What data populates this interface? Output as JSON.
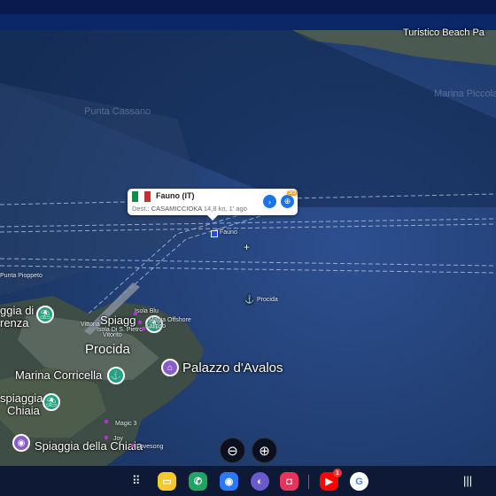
{
  "map": {
    "labels_top": {
      "beach": "Turistico Beach Pa",
      "ghost1": "Punta Cassano",
      "ghost2": "Marina Piccola"
    },
    "vessel": {
      "name_marker": "Fauno",
      "popup_title": "Fauno (IT)",
      "dest_label": "Dest.:",
      "dest_value": "CASAMICCIOKA",
      "speed": "14,8 kn",
      "age": "1' ago",
      "badge": "3/3"
    },
    "places": {
      "punta_pioppeto": "Punta Pioppeto",
      "procida_anchor": "Procida",
      "spiagg_di_lines": [
        "ggia di",
        "renza"
      ],
      "spiagg": "Spiagg",
      "isola_blu": "Isola Blu",
      "magia": "Magia Offshore",
      "kalipso": "Kalipso",
      "vittoria": "Vittoria",
      "isola_di_s_pietro": "Isola Di S. Pietro",
      "vito": "Vitorito",
      "procida_town": "Procida",
      "palazzo": "Palazzo d'Avalos",
      "marina_corricella": "Marina Corricella",
      "spiaggia_chiaia_lines": [
        "spiaggia",
        "Chiaia"
      ],
      "spiaggia_della_chiaia": "Spiaggia della Chiaia",
      "magic3": "Magic 3",
      "joy": "Joy",
      "lovesong": "Lovesong"
    },
    "zoom_out_icon": "zoom-out-icon",
    "zoom_in_icon": "zoom-in-icon"
  },
  "taskbar": {
    "apps": [
      {
        "name": "apps-grid-icon"
      },
      {
        "name": "notes-app-icon",
        "color": "#f7c82c"
      },
      {
        "name": "phone-app-icon",
        "color": "#1fa463"
      },
      {
        "name": "messages-app-icon",
        "color": "#2979ff"
      },
      {
        "name": "internet-app-icon",
        "color": "#6a5acd"
      },
      {
        "name": "camera-app-icon",
        "color": "#e8335a"
      },
      {
        "name": "youtube-app-icon",
        "color": "#ff0000",
        "badge": "1"
      },
      {
        "name": "google-app-icon",
        "color": "#ffffff"
      }
    ],
    "recent_icon": "recent-apps-icon"
  },
  "colors": {
    "sea": "#1d3a72",
    "land": "#3a4a40",
    "track": "#c9d6ee"
  }
}
